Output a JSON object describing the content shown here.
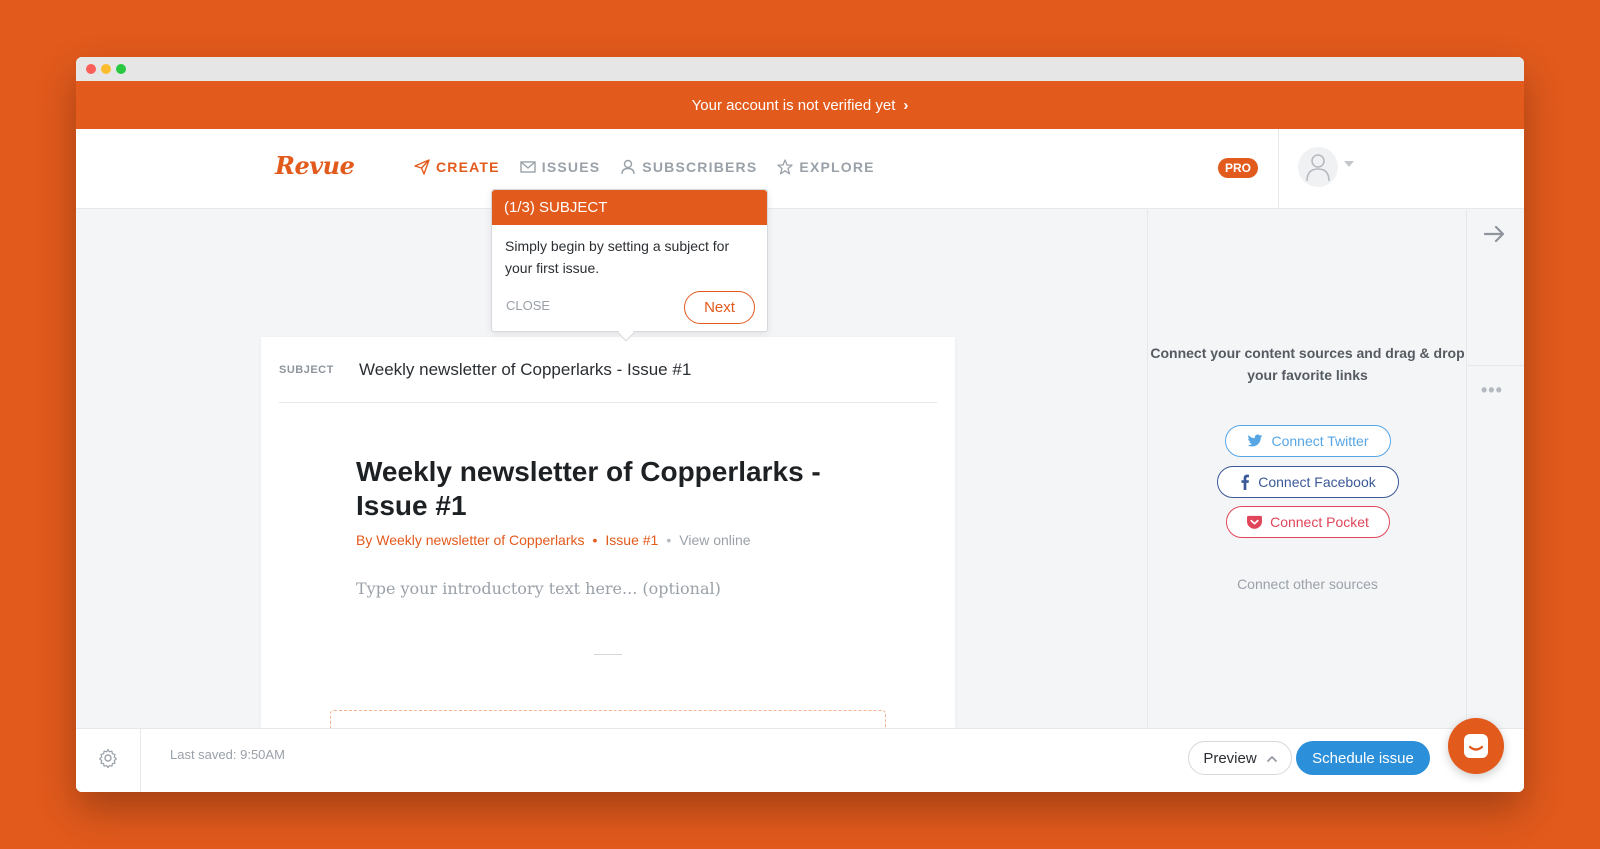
{
  "banner": {
    "text": "Your account is not verified yet",
    "chevron": "›"
  },
  "nav": {
    "logo": "Revue",
    "items": [
      {
        "label": "CREATE",
        "icon": "paper-plane-icon",
        "active": true
      },
      {
        "label": "ISSUES",
        "icon": "envelope-icon",
        "active": false
      },
      {
        "label": "SUBSCRIBERS",
        "icon": "user-icon",
        "active": false
      },
      {
        "label": "EXPLORE",
        "icon": "star-icon",
        "active": false
      }
    ],
    "pro_badge": "PRO"
  },
  "tooltip": {
    "title": "(1/3) SUBJECT",
    "body": "Simply begin by setting a subject for your first issue.",
    "close_label": "CLOSE",
    "next_label": "Next"
  },
  "editor": {
    "subject_label": "SUBJECT",
    "subject_value": "Weekly newsletter of Copperlarks - Issue #1",
    "issue_title": "Weekly newsletter of Copperlarks - Issue #1",
    "byline_author": "By Weekly newsletter of Copperlarks",
    "byline_issue": "Issue #1",
    "byline_view": "View online",
    "intro_placeholder": "Type your introductory text here... (optional)"
  },
  "sidebar": {
    "connect_text": "Connect your content sources and drag & drop your favorite links",
    "twitter_label": "Connect Twitter",
    "facebook_label": "Connect Facebook",
    "pocket_label": "Connect Pocket",
    "other_label": "Connect other sources"
  },
  "bottom": {
    "last_saved": "Last saved: 9:50AM",
    "preview_label": "Preview",
    "schedule_label": "Schedule issue"
  },
  "colors": {
    "brand": "#E25A1C",
    "twitter": "#56A6E6",
    "facebook": "#3B5998",
    "pocket": "#E0455A",
    "primary": "#2C8FD9"
  }
}
